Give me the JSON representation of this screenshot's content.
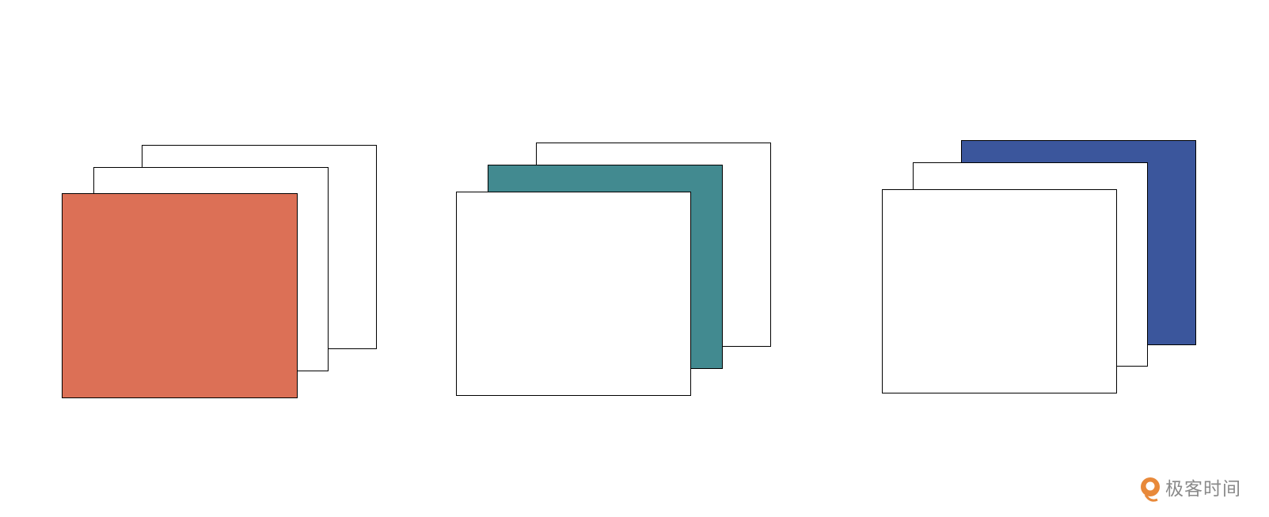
{
  "colors": {
    "background": "#ffffff",
    "stroke": "#000000",
    "empty_fill": "#ffffff",
    "accent_orange": "#DC7056",
    "accent_teal": "#428A90",
    "accent_blue": "#3B569C",
    "watermark_orange": "#E8893A",
    "watermark_text": "#8a8a8a"
  },
  "stacks": [
    {
      "name": "stack-front-highlighted",
      "layers": [
        {
          "role": "back",
          "fill": "#ffffff"
        },
        {
          "role": "middle",
          "fill": "#ffffff"
        },
        {
          "role": "front",
          "fill": "#DC7056"
        }
      ]
    },
    {
      "name": "stack-middle-highlighted",
      "layers": [
        {
          "role": "back",
          "fill": "#ffffff"
        },
        {
          "role": "middle",
          "fill": "#428A90"
        },
        {
          "role": "front",
          "fill": "#ffffff"
        }
      ]
    },
    {
      "name": "stack-back-highlighted",
      "layers": [
        {
          "role": "back",
          "fill": "#3B569C"
        },
        {
          "role": "middle",
          "fill": "#ffffff"
        },
        {
          "role": "front",
          "fill": "#ffffff"
        }
      ]
    }
  ],
  "watermark": {
    "text": "极客时间",
    "icon": "geektime-logo-icon"
  }
}
